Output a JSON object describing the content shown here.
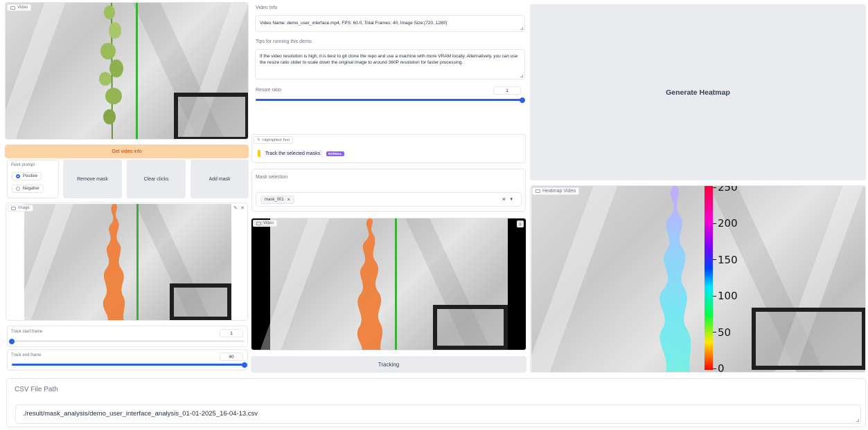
{
  "left_video": {
    "tag_label": "Video"
  },
  "get_video_info_label": "Get video info",
  "point_prompt": {
    "label": "Point prompt",
    "positive": "Positive",
    "negative": "Negative",
    "selected": "Positive"
  },
  "buttons": {
    "remove_mask": "Remove mask",
    "clear_clicks": "Clear clicks",
    "add_mask": "Add mask"
  },
  "image_panel": {
    "tag_label": "Image"
  },
  "track_start": {
    "label": "Track start frame",
    "value": "1",
    "fraction": 0.0
  },
  "track_end": {
    "label": "Track end frame",
    "value": "40",
    "fraction": 1.0
  },
  "video_info": {
    "label": "Video Info",
    "value": "Video Name: demo_user_interface.mp4, FPS: 60.0, Total Frames: 40, Image Size:(720, 1280)"
  },
  "tips": {
    "label": "Tips for running this demo.",
    "value": "If the video resolution is high, it is best to git clone the repo and use a machine with more VRAM locally. Alternatively, you can use the resize ratio slider to scale down the original image to around 360P resolution for faster processing."
  },
  "resize": {
    "label": "Resize ratio",
    "value": "1",
    "fraction": 1.0
  },
  "highlighted": {
    "tag_label": "Highlighted Text",
    "text": "Track the selected masks.",
    "badge": "NORMAL"
  },
  "mask_selection": {
    "label": "Mask selection",
    "chip": "mask_001",
    "chip_close": "×",
    "clear": "×",
    "arrow": "▾"
  },
  "middle_video": {
    "tag_label": "Video"
  },
  "tracking_label": "Tracking",
  "generate_heatmap_label": "Generate Heatmap",
  "heatmap_video": {
    "tag_label": "Heatmap Video"
  },
  "colorbar": {
    "ticks": [
      "250",
      "200",
      "150",
      "100",
      "50",
      "0"
    ]
  },
  "csv": {
    "label": "CSV File Path",
    "value": "./result/mask_analysis/demo_user_interface_analysis_01-01-2025_16-04-13.csv"
  },
  "colors": {
    "accent": "#2563eb",
    "orange_button": "#fbd3a4",
    "mask_orange": "#ee7f3c",
    "badge_purple": "#8b5cf6"
  },
  "icons": {
    "close": "close-icon",
    "download": "download-icon",
    "video": "video-icon",
    "image": "image-icon"
  }
}
